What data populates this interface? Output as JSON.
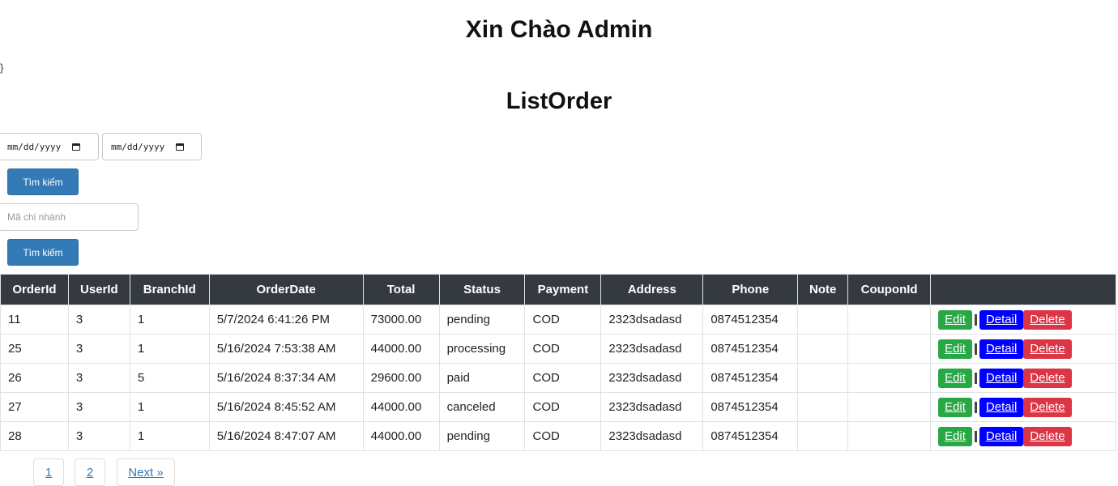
{
  "header": {
    "welcome": "Xin Chào Admin",
    "stray": "}"
  },
  "page_title": "ListOrder",
  "filters": {
    "date_from_placeholder": "mm/dd/yyyy",
    "date_to_placeholder": "mm/dd/yyyy",
    "search_label": "Tìm kiếm",
    "branch_placeholder": "Mã chi nhánh",
    "branch_search_label": "Tìm kiếm"
  },
  "table": {
    "columns": [
      "OrderId",
      "UserId",
      "BranchId",
      "OrderDate",
      "Total",
      "Status",
      "Payment",
      "Address",
      "Phone",
      "Note",
      "CouponId",
      ""
    ],
    "rows": [
      [
        "11",
        "3",
        "1",
        "5/7/2024 6:41:26 PM",
        "73000.00",
        "pending",
        "COD",
        "2323dsadasd",
        "0874512354",
        "",
        ""
      ],
      [
        "25",
        "3",
        "1",
        "5/16/2024 7:53:38 AM",
        "44000.00",
        "processing",
        "COD",
        "2323dsadasd",
        "0874512354",
        "",
        ""
      ],
      [
        "26",
        "3",
        "5",
        "5/16/2024 8:37:34 AM",
        "29600.00",
        "paid",
        "COD",
        "2323dsadasd",
        "0874512354",
        "",
        ""
      ],
      [
        "27",
        "3",
        "1",
        "5/16/2024 8:45:52 AM",
        "44000.00",
        "canceled",
        "COD",
        "2323dsadasd",
        "0874512354",
        "",
        ""
      ],
      [
        "28",
        "3",
        "1",
        "5/16/2024 8:47:07 AM",
        "44000.00",
        "pending",
        "COD",
        "2323dsadasd",
        "0874512354",
        "",
        ""
      ]
    ],
    "actions": {
      "edit": "Edit",
      "detail": "Detail",
      "delete": "Delete"
    }
  },
  "pagination": {
    "pages": [
      "1",
      "2"
    ],
    "next": "Next »"
  }
}
